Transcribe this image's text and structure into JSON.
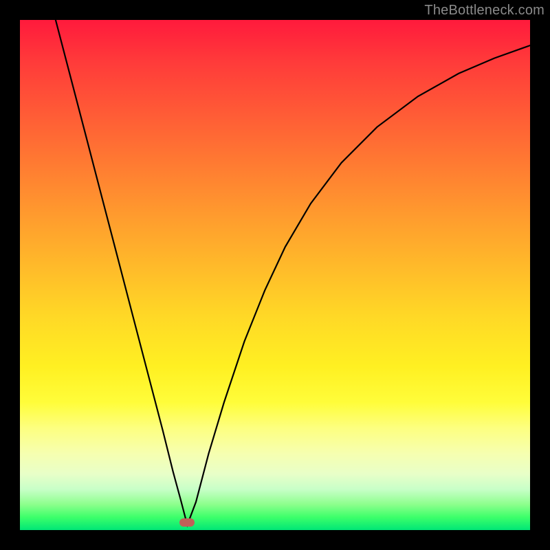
{
  "watermark": "TheBottleneck.com",
  "marker": {
    "x_frac": 0.328,
    "y_frac": 0.985
  },
  "chart_data": {
    "type": "line",
    "title": "",
    "xlabel": "",
    "ylabel": "",
    "xlim": [
      0,
      1
    ],
    "ylim": [
      0,
      1
    ],
    "series": [
      {
        "name": "curve",
        "x": [
          0.07,
          0.1,
          0.13,
          0.16,
          0.19,
          0.22,
          0.25,
          0.28,
          0.3,
          0.315,
          0.328,
          0.345,
          0.37,
          0.4,
          0.44,
          0.48,
          0.52,
          0.57,
          0.63,
          0.7,
          0.78,
          0.86,
          0.93,
          1.0
        ],
        "y": [
          1.0,
          0.885,
          0.77,
          0.655,
          0.54,
          0.425,
          0.31,
          0.195,
          0.115,
          0.06,
          0.01,
          0.055,
          0.15,
          0.25,
          0.37,
          0.47,
          0.555,
          0.64,
          0.72,
          0.79,
          0.85,
          0.895,
          0.925,
          0.95
        ]
      }
    ],
    "annotations": [
      {
        "type": "marker",
        "x": 0.328,
        "y": 0.015,
        "color": "#c06058"
      }
    ],
    "background_gradient": {
      "direction": "vertical",
      "stops": [
        {
          "pos": 0.0,
          "color": "#ff1a3c"
        },
        {
          "pos": 0.5,
          "color": "#ffc827"
        },
        {
          "pos": 0.75,
          "color": "#fffd3a"
        },
        {
          "pos": 1.0,
          "color": "#00e676"
        }
      ]
    }
  }
}
